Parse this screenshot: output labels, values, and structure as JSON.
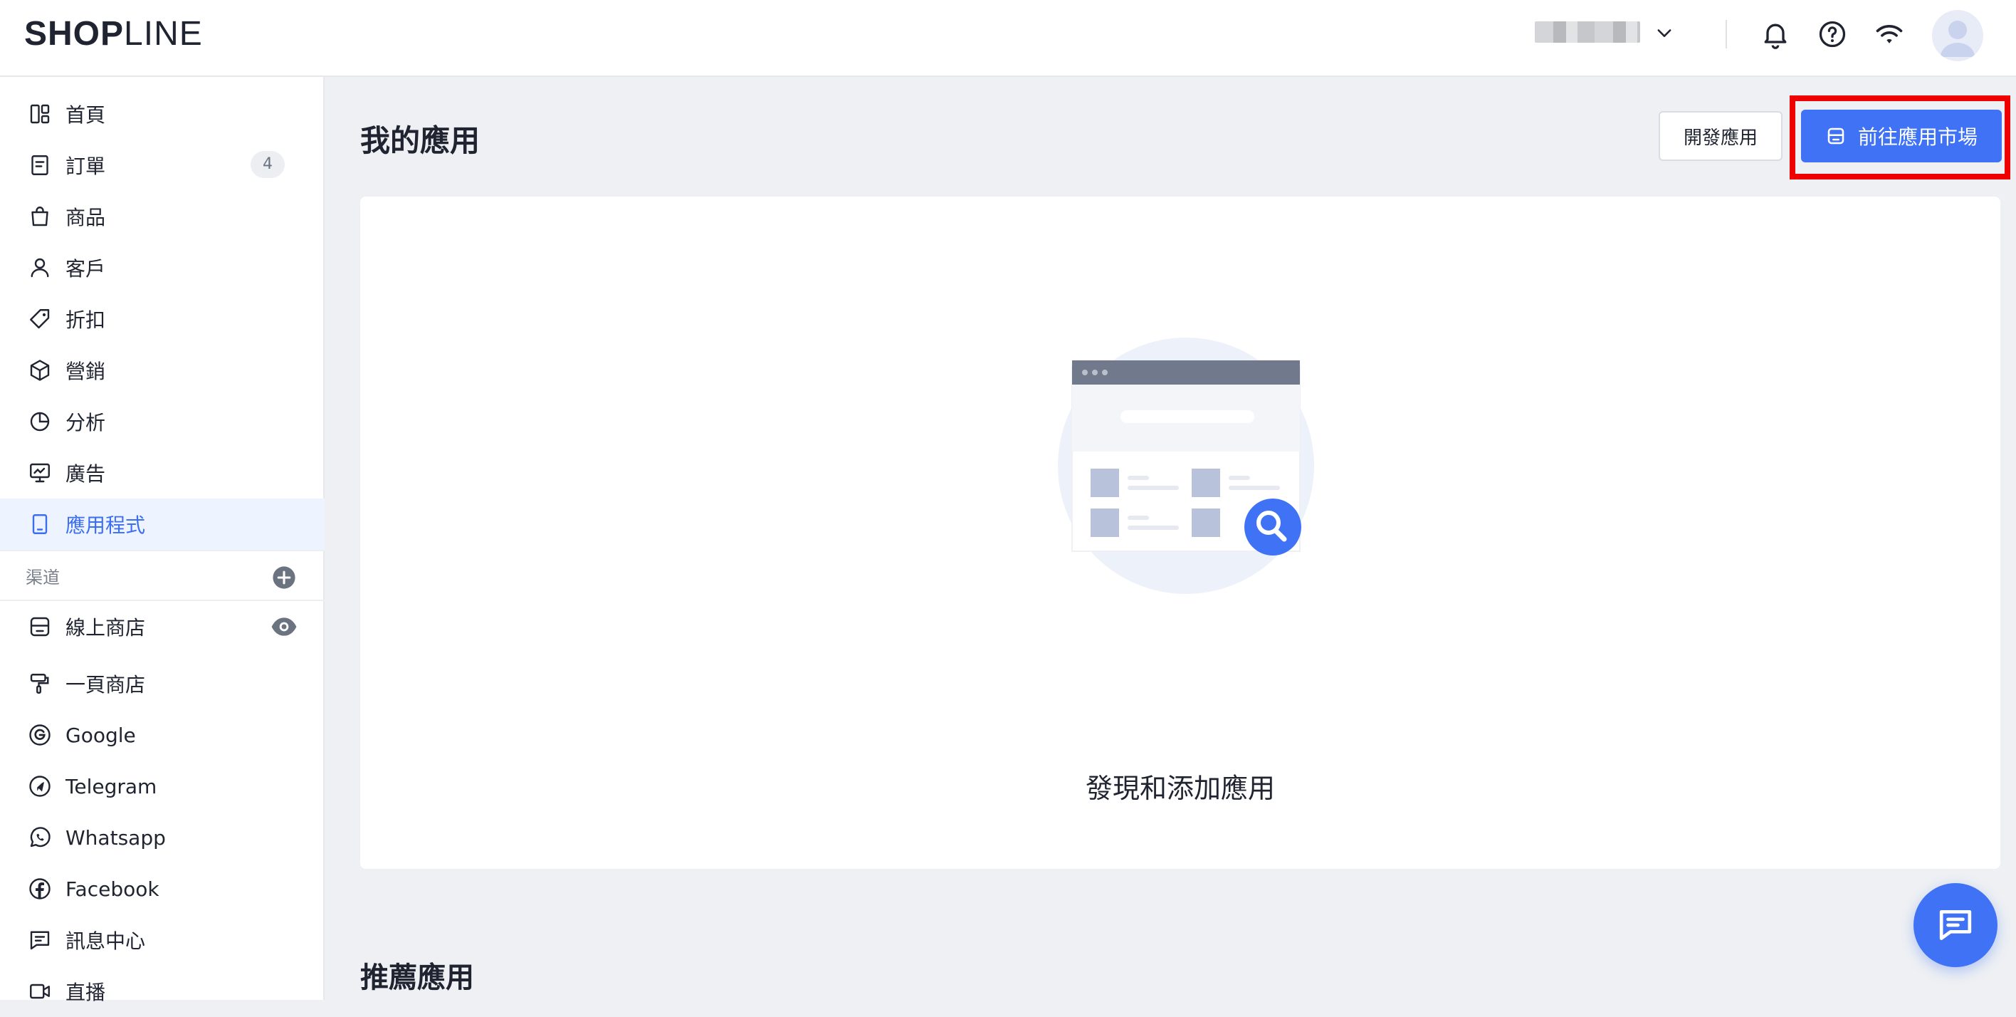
{
  "header": {
    "logo_part1": "SHOP",
    "logo_part2": "LINE",
    "colors": {
      "accent": "#3f72f5",
      "highlight_frame": "#ee0000"
    }
  },
  "sidebar": {
    "items": [
      {
        "label": "首頁",
        "icon": "dashboard-icon"
      },
      {
        "label": "訂單",
        "icon": "order-icon",
        "badge": "4"
      },
      {
        "label": "商品",
        "icon": "shopping-bag-icon"
      },
      {
        "label": "客戶",
        "icon": "person-icon"
      },
      {
        "label": "折扣",
        "icon": "tag-icon"
      },
      {
        "label": "營銷",
        "icon": "cube-icon"
      },
      {
        "label": "分析",
        "icon": "pie-chart-icon"
      },
      {
        "label": "廣告",
        "icon": "ad-monitor-icon"
      },
      {
        "label": "應用程式",
        "icon": "app-icon",
        "active": true
      }
    ],
    "channels_heading": "渠道",
    "channels": [
      {
        "label": "線上商店",
        "icon": "storefront-icon"
      },
      {
        "label": "一頁商店",
        "icon": "paint-roller-icon"
      },
      {
        "label": "Google",
        "icon": "google-icon"
      },
      {
        "label": "Telegram",
        "icon": "telegram-icon"
      },
      {
        "label": "Whatsapp",
        "icon": "whatsapp-icon"
      },
      {
        "label": "Facebook",
        "icon": "facebook-icon"
      },
      {
        "label": "訊息中心",
        "icon": "message-center-icon"
      },
      {
        "label": "直播",
        "icon": "live-video-icon"
      }
    ]
  },
  "main": {
    "title": "我的應用",
    "develop_button": "開發應用",
    "market_button": "前往應用市場",
    "empty_text": "發現和添加應用",
    "recommended_title": "推薦應用"
  }
}
